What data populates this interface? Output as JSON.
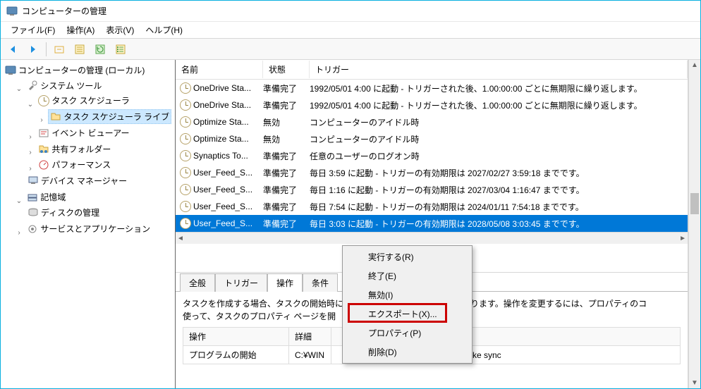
{
  "window": {
    "title": "コンピューターの管理"
  },
  "menu": {
    "file": "ファイル(F)",
    "action": "操作(A)",
    "view": "表示(V)",
    "help": "ヘルプ(H)"
  },
  "tree": {
    "root": "コンピューターの管理 (ローカル)",
    "systools": "システム ツール",
    "scheduler": "タスク スケジューラ",
    "schedlib": "タスク スケジューラ ライブ",
    "event": "イベント ビューアー",
    "shared": "共有フォルダー",
    "perf": "パフォーマンス",
    "devmgr": "デバイス マネージャー",
    "storage": "記憶域",
    "diskmgmt": "ディスクの管理",
    "services": "サービスとアプリケーション"
  },
  "grid": {
    "headers": {
      "name": "名前",
      "state": "状態",
      "trigger": "トリガー"
    },
    "rows": [
      {
        "name": "OneDrive Sta...",
        "state": "準備完了",
        "trigger": "1992/05/01 4:00 に起動 - トリガーされた後、1.00:00:00 ごとに無期限に繰り返します。"
      },
      {
        "name": "OneDrive Sta...",
        "state": "準備完了",
        "trigger": "1992/05/01 4:00 に起動 - トリガーされた後、1.00:00:00 ごとに無期限に繰り返します。"
      },
      {
        "name": "Optimize Sta...",
        "state": "無効",
        "trigger": "コンピューターのアイドル時"
      },
      {
        "name": "Optimize Sta...",
        "state": "無効",
        "trigger": "コンピューターのアイドル時"
      },
      {
        "name": "Synaptics To...",
        "state": "準備完了",
        "trigger": "任意のユーザーのログオン時"
      },
      {
        "name": "User_Feed_S...",
        "state": "準備完了",
        "trigger": "毎日 3:59 に起動 - トリガーの有効期限は 2027/02/27 3:59:18 までです。"
      },
      {
        "name": "User_Feed_S...",
        "state": "準備完了",
        "trigger": "毎日 1:16 に起動 - トリガーの有効期限は 2027/03/04 1:16:47 までです。"
      },
      {
        "name": "User_Feed_S...",
        "state": "準備完了",
        "trigger": "毎日 7:54 に起動 - トリガーの有効期限は 2024/01/11 7:54:18 までです。"
      },
      {
        "name": "User_Feed_S...",
        "state": "準備完了",
        "trigger": "毎日 3:03 に起動 - トリガーの有効期限は 2028/05/08 3:03:45 までです。",
        "selected": true
      }
    ]
  },
  "detail": {
    "tabs": {
      "general": "全般",
      "triggers": "トリガー",
      "actions": "操作",
      "conditions": "条件"
    },
    "desc": "タスクを作成する場合、タスクの開始時に発生する操作を指定する必要があります。操作を変更するには、プロパティのコ\n使って、タスクのプロパティ ページを開",
    "table": {
      "action_hdr": "操作",
      "detail_hdr": "詳細",
      "action_val": "プログラムの開始",
      "detail_val": "C:¥WIN",
      "detail_tail": "ke sync"
    }
  },
  "context": {
    "run": "実行する(R)",
    "end": "終了(E)",
    "disable": "無効(I)",
    "export": "エクスポート(X)...",
    "properties": "プロパティ(P)",
    "delete": "削除(D)"
  }
}
